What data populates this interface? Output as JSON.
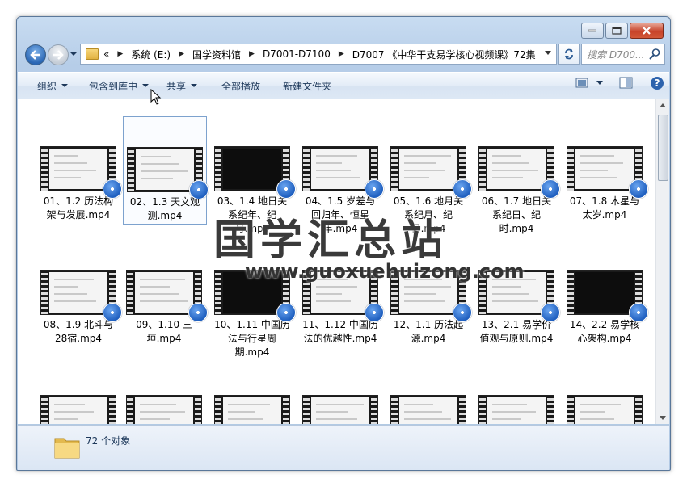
{
  "window": {
    "caption_buttons": {
      "minimize": "minimize",
      "maximize": "maximize",
      "close": "close"
    }
  },
  "address_bar": {
    "prefix": "«",
    "crumbs": [
      "系统 (E:)",
      "国学资料馆",
      "D7001-D7100",
      "D7007 《中华干支易学核心视频课》72集"
    ],
    "search_placeholder": "搜索 D700..."
  },
  "toolbar": {
    "organize": "组织",
    "include_in_library": "包含到库中",
    "share": "共享",
    "play_all": "全部播放",
    "new_folder": "新建文件夹"
  },
  "files": [
    {
      "name": "01、1.2 历法构架与发展.mp4",
      "thumb": "light"
    },
    {
      "name": "02、1.3 天文观测.mp4",
      "thumb": "light",
      "selected": true
    },
    {
      "name": "03、1.4 地日关系纪年、纪月.mp4",
      "thumb": "dark"
    },
    {
      "name": "04、1.5 岁差与回归年、恒星年.mp4",
      "thumb": "light"
    },
    {
      "name": "05、1.6 地月关系纪月、纪日.mp4",
      "thumb": "light"
    },
    {
      "name": "06、1.7 地日关系纪日、纪时.mp4",
      "thumb": "light"
    },
    {
      "name": "07、1.8 木星与太岁.mp4",
      "thumb": "light"
    },
    {
      "name": "08、1.9 北斗与28宿.mp4",
      "thumb": "light"
    },
    {
      "name": "09、1.10 三垣.mp4",
      "thumb": "light"
    },
    {
      "name": "10、1.11 中国历法与行星周期.mp4",
      "thumb": "dark"
    },
    {
      "name": "11、1.12 中国历法的优越性.mp4",
      "thumb": "light"
    },
    {
      "name": "12、1.1 历法起源.mp4",
      "thumb": "light"
    },
    {
      "name": "13、2.1 易学价值观与原则.mp4",
      "thumb": "light"
    },
    {
      "name": "14、2.2 易学核心架构.mp4",
      "thumb": "dark"
    },
    {
      "name": "",
      "thumb": "light"
    },
    {
      "name": "",
      "thumb": "light"
    },
    {
      "name": "",
      "thumb": "light"
    },
    {
      "name": "",
      "thumb": "light"
    },
    {
      "name": "",
      "thumb": "light"
    },
    {
      "name": "",
      "thumb": "light"
    },
    {
      "name": "",
      "thumb": "light"
    }
  ],
  "watermark": {
    "title": "国学汇总站",
    "url": "www.guoxuehuizong.com"
  },
  "status": {
    "count": "72 个对象"
  }
}
